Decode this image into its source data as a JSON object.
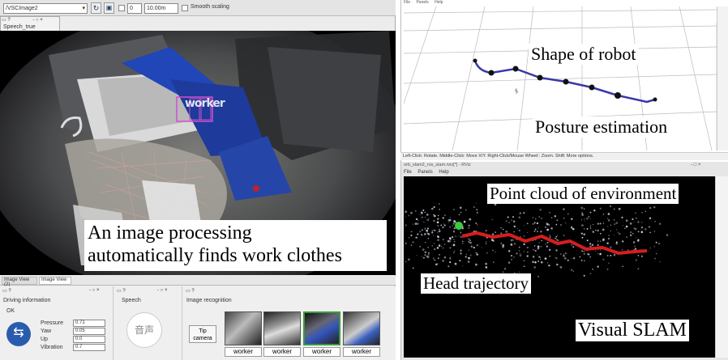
{
  "left_panel": {
    "topic_path": "/VSCImage2",
    "frame_value": "0",
    "hz_value": "10.00m",
    "smooth_label": "Smooth scaling",
    "speech_true_label": "Speech_true",
    "speech_button_glyph": "音声",
    "detection_label": "worker",
    "caption": "An image processing\nautomatically finds work clothes",
    "tabs": [
      "Image View (2)",
      "Image View"
    ],
    "driving": {
      "title": "Driving information",
      "status": "OK",
      "fields": [
        {
          "label": "Pressure",
          "value": "0.71"
        },
        {
          "label": "Yaw",
          "value": "0.05"
        },
        {
          "label": "Up",
          "value": "0.0"
        },
        {
          "label": "Vibration",
          "value": "0.7"
        }
      ]
    },
    "speech": {
      "title": "Speech",
      "glyph": "音声"
    },
    "recognition": {
      "title": "Image recognition",
      "camera_button": "Tip camera",
      "labels": [
        "worker",
        "worker",
        "worker",
        "worker"
      ]
    }
  },
  "right_top": {
    "menu": [
      "File",
      "Panels",
      "Help"
    ],
    "status_text": "Left-Click: Rotate. Middle-Click: Move X/Y. Right-Click/Mouse Wheel:: Zoom. Shift: More options.",
    "caption_shape": "Shape of robot",
    "caption_posture": "Posture estimation"
  },
  "right_bottom": {
    "title_text": "orb_slam2_ros_slam.rviz[*] - RViz",
    "menu": [
      "File",
      "Panels",
      "Help"
    ],
    "caption_cloud": "Point cloud of environment",
    "caption_head": "Head trajectory",
    "caption_slam": "Visual SLAM"
  }
}
